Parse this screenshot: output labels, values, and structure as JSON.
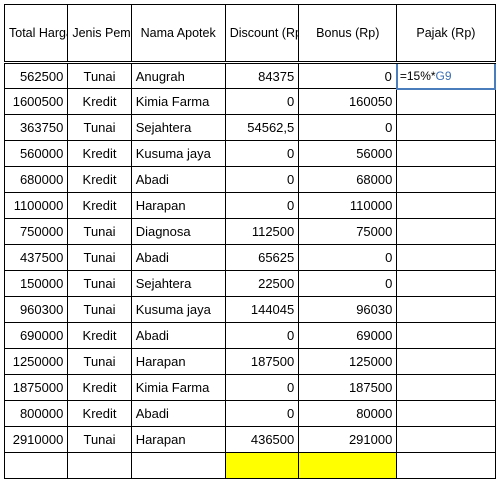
{
  "headers": {
    "total": "Total Harga (Rp)",
    "jenis": "Jenis Pembaya ran",
    "nama": "Nama Apotek",
    "discount": "Discount (Rp)",
    "bonus": "Bonus (Rp)",
    "pajak": "Pajak (Rp)"
  },
  "formula": {
    "prefix": "=15%*",
    "ref": "G9"
  },
  "rows": [
    {
      "total": "562500",
      "jenis": "Tunai",
      "nama": "Anugrah",
      "discount": "84375",
      "bonus": "0",
      "pajak_formula": true
    },
    {
      "total": "1600500",
      "jenis": "Kredit",
      "nama": "Kimia Farma",
      "discount": "0",
      "bonus": "160050",
      "pajak": ""
    },
    {
      "total": "363750",
      "jenis": "Tunai",
      "nama": "Sejahtera",
      "discount": "54562,5",
      "bonus": "0",
      "pajak": ""
    },
    {
      "total": "560000",
      "jenis": "Kredit",
      "nama": "Kusuma jaya",
      "discount": "0",
      "bonus": "56000",
      "pajak": ""
    },
    {
      "total": "680000",
      "jenis": "Kredit",
      "nama": "Abadi",
      "discount": "0",
      "bonus": "68000",
      "pajak": ""
    },
    {
      "total": "1100000",
      "jenis": "Kredit",
      "nama": "Harapan",
      "discount": "0",
      "bonus": "110000",
      "pajak": ""
    },
    {
      "total": "750000",
      "jenis": "Tunai",
      "nama": "Diagnosa",
      "discount": "112500",
      "bonus": "75000",
      "pajak": ""
    },
    {
      "total": "437500",
      "jenis": "Tunai",
      "nama": "Abadi",
      "discount": "65625",
      "bonus": "0",
      "pajak": ""
    },
    {
      "total": "150000",
      "jenis": "Tunai",
      "nama": "Sejahtera",
      "discount": "22500",
      "bonus": "0",
      "pajak": ""
    },
    {
      "total": "960300",
      "jenis": "Tunai",
      "nama": "Kusuma jaya",
      "discount": "144045",
      "bonus": "96030",
      "pajak": ""
    },
    {
      "total": "690000",
      "jenis": "Kredit",
      "nama": "Abadi",
      "discount": "0",
      "bonus": "69000",
      "pajak": ""
    },
    {
      "total": "1250000",
      "jenis": "Tunai",
      "nama": "Harapan",
      "discount": "187500",
      "bonus": "125000",
      "pajak": ""
    },
    {
      "total": "1875000",
      "jenis": "Kredit",
      "nama": "Kimia Farma",
      "discount": "0",
      "bonus": "187500",
      "pajak": ""
    },
    {
      "total": "800000",
      "jenis": "Kredit",
      "nama": "Abadi",
      "discount": "0",
      "bonus": "80000",
      "pajak": ""
    },
    {
      "total": "2910000",
      "jenis": "Tunai",
      "nama": "Harapan",
      "discount": "436500",
      "bonus": "291000",
      "pajak": ""
    }
  ]
}
